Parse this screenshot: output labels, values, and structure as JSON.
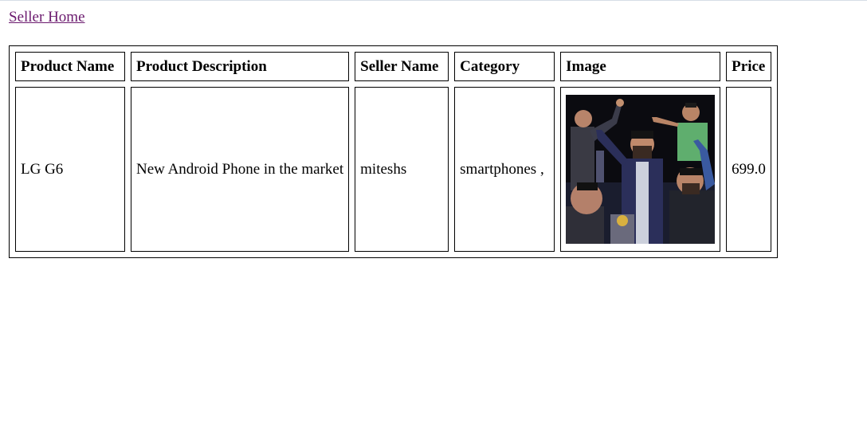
{
  "page": {
    "top_link": "Seller Home"
  },
  "table": {
    "headers": {
      "product_name": "Product Name",
      "product_description": "Product Description",
      "seller_name": "Seller Name",
      "category": "Category",
      "image": "Image",
      "price": "Price"
    },
    "rows": [
      {
        "product_name": "LG G6",
        "product_description": "New Android Phone in the market",
        "seller_name": "miteshs",
        "category": "smartphones ,",
        "price": "699.0"
      }
    ]
  },
  "colors": {
    "link_visited": "#6b1a6e",
    "border": "#000000",
    "background": "#ffffff"
  }
}
